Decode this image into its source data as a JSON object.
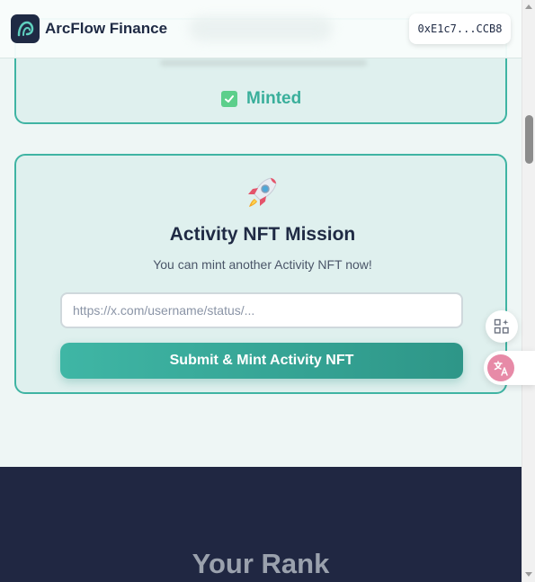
{
  "header": {
    "brand": "ArcFlow Finance",
    "wallet_address": "0xE1c7...CCB8"
  },
  "minted_card": {
    "status_label": "Minted"
  },
  "mission_card": {
    "icon": "rocket-icon",
    "title": "Activity NFT Mission",
    "subtitle": "You can mint another Activity NFT now!",
    "url_input": {
      "value": "",
      "placeholder": "https://x.com/username/status/..."
    },
    "submit_label": "Submit & Mint Activity NFT"
  },
  "rank_section": {
    "title": "Your Rank"
  },
  "side_widgets": {
    "apps_icon": "apps-sparkle-icon",
    "translate_icon": "translate-icon"
  },
  "colors": {
    "accent": "#3fb4a3",
    "navy": "#1f2a44",
    "rank_bg": "#202742",
    "minted_text": "#3aaf9b"
  }
}
